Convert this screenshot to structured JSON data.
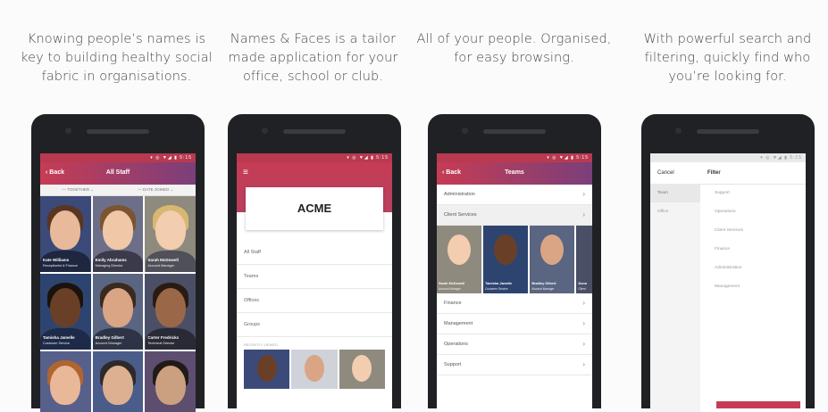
{
  "panels": [
    {
      "caption": "Knowing people’s names is\nkey to building healthy social\nfabric in organisations."
    },
    {
      "caption": "Names & Faces is a tailor\nmade application for your\noffice, school or club."
    },
    {
      "caption": "All of your people. Organised,\nfor easy browsing."
    },
    {
      "caption": "With powerful search and\nfiltering, quickly find who\nyou’re looking for."
    }
  ],
  "status": "▾ ◎ ▼◢ ▮ 5:15",
  "screen1": {
    "back": "‹ Back",
    "title": "All Staff",
    "sort_left": "— TOGETHER ⌄",
    "sort_right": "— DATE JOINED ⌄",
    "people": [
      {
        "name": "Kate Williams",
        "role": "Receptionist & Finance"
      },
      {
        "name": "Emily Abrahams",
        "role": "Managing Director"
      },
      {
        "name": "Sarah McDowell",
        "role": "Account Manager"
      },
      {
        "name": "Tamisha Jamelle",
        "role": "Customer Service"
      },
      {
        "name": "Bradley Gilbert",
        "role": "Account Manager"
      },
      {
        "name": "Carter Fredricks",
        "role": "Technical Director"
      },
      {
        "name": "",
        "role": ""
      },
      {
        "name": "",
        "role": ""
      },
      {
        "name": "",
        "role": ""
      }
    ]
  },
  "screen2": {
    "menu_icon": "≡",
    "brand": "ACME",
    "items": [
      "All Staff",
      "Teams",
      "Offices",
      "Groups"
    ],
    "section": "RECENTLY VIEWED"
  },
  "screen3": {
    "back": "‹ Back",
    "title": "Teams",
    "teams_top": [
      "Administration",
      "Client Services"
    ],
    "faces": [
      {
        "name": "Sarah McDowell",
        "role": "Account Manager"
      },
      {
        "name": "Tamisha Jamelle",
        "role": "Customer Service"
      },
      {
        "name": "Bradley Gilbert",
        "role": "Account Manager"
      },
      {
        "name": "Dunn",
        "role": "Client"
      }
    ],
    "teams_bottom": [
      "Finance",
      "Management",
      "Operations",
      "Support"
    ]
  },
  "screen4": {
    "cancel": "Cancel",
    "title": "Filter",
    "left": [
      "Team",
      "Office"
    ],
    "right": [
      "Support",
      "Operations",
      "Client Services",
      "Finance",
      "Administration",
      "Management"
    ]
  },
  "colors": {
    "accent": "#c63c54",
    "accent2": "#7b3f7a"
  }
}
